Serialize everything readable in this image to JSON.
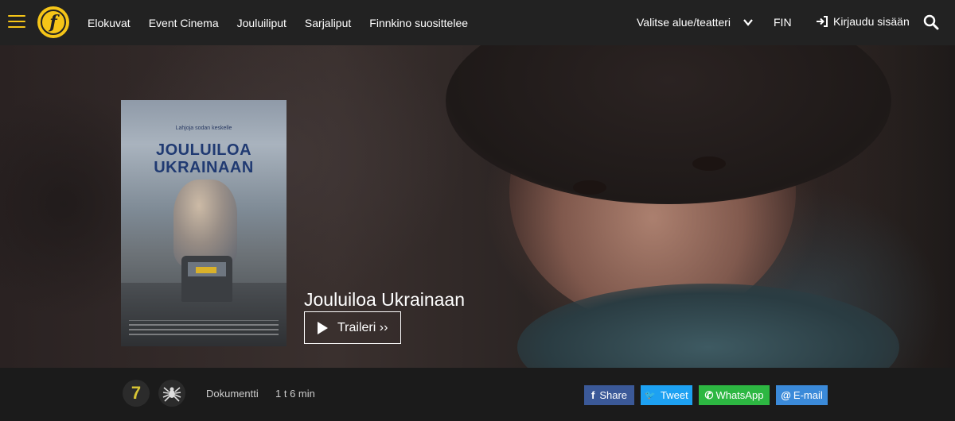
{
  "header": {
    "logo_letter": "f",
    "nav": [
      {
        "label": "Elokuvat"
      },
      {
        "label": "Event Cinema"
      },
      {
        "label": "Jouluiliput"
      },
      {
        "label": "Sarjaliput"
      },
      {
        "label": "Finnkino suosittelee"
      }
    ],
    "region_label": "Valitse alue/teatteri",
    "language": "FIN",
    "login_label": "Kirjaudu sisään"
  },
  "hero": {
    "poster": {
      "tagline": "Lahjoja sodan keskelle",
      "title_line1": "JOULUILOA",
      "title_line2": "UKRAINAAN"
    },
    "movie_title": "Jouluiloa Ukrainaan",
    "trailer_label": "Traileri ››"
  },
  "info": {
    "age_rating": "7",
    "content_icon": "spider-icon",
    "genre": "Dokumentti",
    "duration": "1 t 6 min"
  },
  "share": {
    "facebook": {
      "label": "Share",
      "icon": "f",
      "color": "#3b5998"
    },
    "twitter": {
      "label": "Tweet",
      "icon": "🐦",
      "color": "#1da1f2"
    },
    "whatsapp": {
      "label": "WhatsApp",
      "icon": "✆",
      "color": "#2db742"
    },
    "email": {
      "label": "E-mail",
      "icon": "@",
      "color": "#3b8ad9"
    }
  },
  "colors": {
    "accent": "#f5c518",
    "topbar": "#222222",
    "background": "#1b1b1b"
  }
}
